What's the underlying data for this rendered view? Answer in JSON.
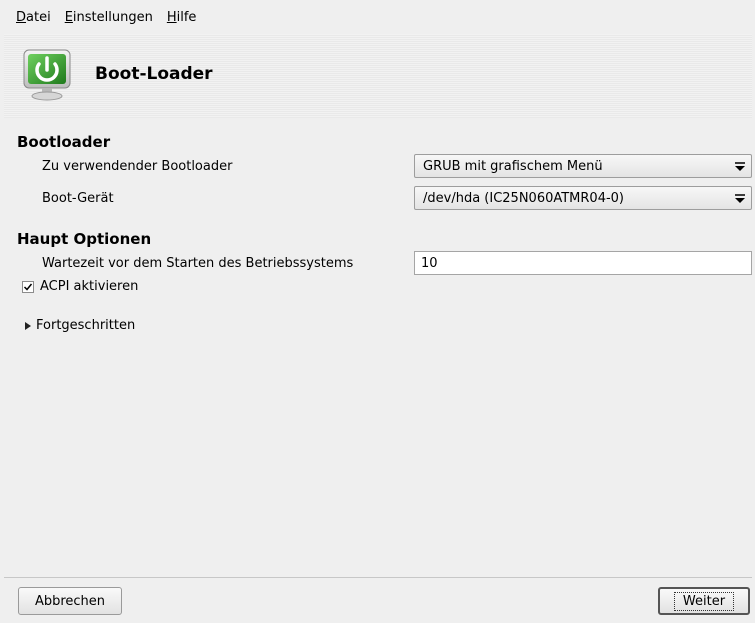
{
  "menubar": {
    "items": [
      {
        "first": "D",
        "rest": "atei"
      },
      {
        "first": "E",
        "rest": "instellungen"
      },
      {
        "first": "H",
        "rest": "ilfe"
      }
    ]
  },
  "header": {
    "title": "Boot-Loader",
    "icon": "bootloader-power-monitor-icon"
  },
  "bootloader_section": {
    "title": "Bootloader",
    "loader_label": "Zu verwendender Bootloader",
    "loader_value": "GRUB mit grafischem Menü",
    "device_label": "Boot-Gerät",
    "device_value": "/dev/hda (IC25N060ATMR04-0)"
  },
  "main_options": {
    "title": "Haupt Optionen",
    "timeout_label": "Wartezeit vor dem Starten des Betriebssystems",
    "timeout_value": "10",
    "acpi_label": "ACPI aktivieren",
    "acpi_checked": true
  },
  "advanced": {
    "label": "Fortgeschritten"
  },
  "buttons": {
    "cancel": "Abbrechen",
    "next": "Weiter"
  },
  "colors": {
    "background": "#efefef",
    "icon_green": "#3aa32f"
  }
}
